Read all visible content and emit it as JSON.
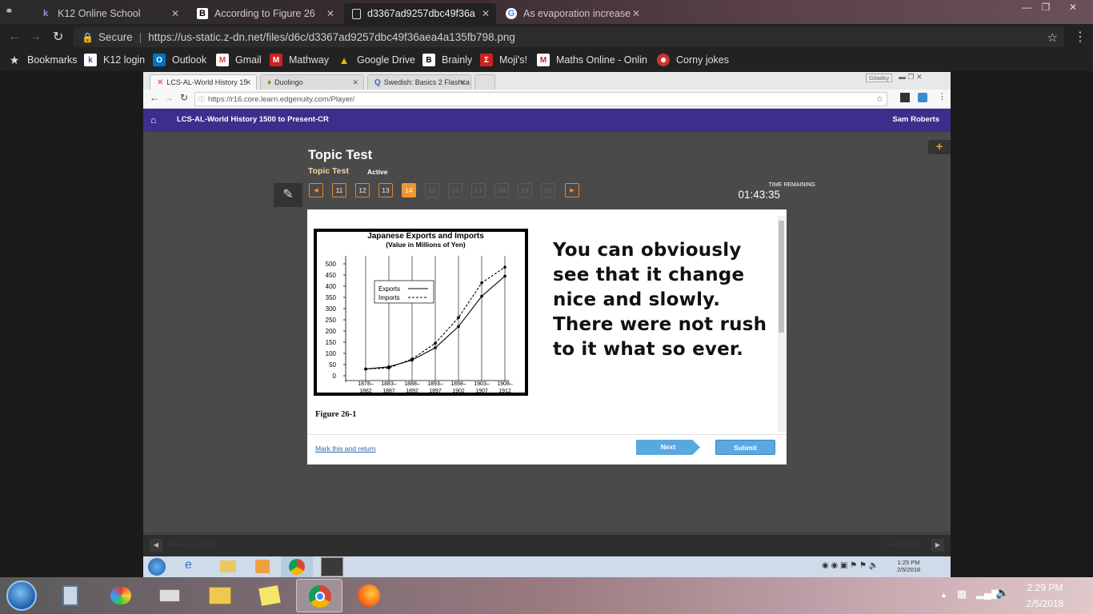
{
  "outer_tabs": [
    {
      "label": "K12 Online School",
      "icon": "k12-icon"
    },
    {
      "label": "According to Figure 26",
      "icon": "brainly-icon"
    },
    {
      "label": "d3367ad9257dbc49f36a",
      "icon": "page-icon"
    },
    {
      "label": "As evaporation increase",
      "icon": "google-icon"
    }
  ],
  "outer_toolbar": {
    "secure_label": "Secure",
    "url": "https://us-static.z-dn.net/files/d6c/d3367ad9257dbc49f36aea4a135fb798.png"
  },
  "bookmarks": [
    {
      "label": "Bookmarks"
    },
    {
      "label": "K12 login"
    },
    {
      "label": "Outlook"
    },
    {
      "label": "Gmail"
    },
    {
      "label": "Mathway"
    },
    {
      "label": "Google Drive"
    },
    {
      "label": "Brainly"
    },
    {
      "label": "Moji's!"
    },
    {
      "label": "Maths Online - Onlin"
    },
    {
      "label": "Corny jokes"
    }
  ],
  "inner_tabs": [
    {
      "label": "LCS-AL-World History 15"
    },
    {
      "label": "Duolingo"
    },
    {
      "label": "Swedish: Basics 2 Flashca"
    }
  ],
  "inner_url": "https://r16.core.learn.edgenuity.com/Player/",
  "inner_profile": "Gitadsy",
  "course": {
    "title": "LCS-AL-World History 1500 to Present-CR",
    "user": "Sam Roberts"
  },
  "test": {
    "heading": "Topic Test",
    "subheading": "Topic Test",
    "status": "Active",
    "time_label": "TIME REMAINING",
    "time_value": "01:43:35",
    "questions": [
      "11",
      "12",
      "13",
      "14",
      "15",
      "16",
      "17",
      "18",
      "19",
      "20"
    ],
    "current": "14"
  },
  "figure_caption": "Figure 26-1",
  "essay_text": "You can obviously see that it change nice and slowly. There were not rush to it what so ever.",
  "actions": {
    "mark_label": "Mark this and return",
    "next_label": "Next",
    "submit_label": "Submit"
  },
  "footer": {
    "prev_label": "Previous Activity",
    "next_label": "Next Activity"
  },
  "inner_clock": {
    "time": "1:25 PM",
    "date": "2/5/2018"
  },
  "clock": {
    "time": "2:29 PM",
    "date": "2/5/2018"
  },
  "chart_data": {
    "type": "line",
    "title": "Japanese Exports and Imports",
    "subtitle": "(Value in Millions of Yen)",
    "categories": [
      "1878-1882",
      "1883-1887",
      "1888-1892",
      "1893-1897",
      "1898-1902",
      "1903-1907",
      "1908-1912"
    ],
    "series": [
      {
        "name": "Exports",
        "values": [
          30,
          40,
          70,
          125,
          220,
          355,
          445
        ],
        "style": "solid"
      },
      {
        "name": "Imports",
        "values": [
          30,
          35,
          75,
          145,
          260,
          415,
          485
        ],
        "style": "dashed"
      }
    ],
    "y_ticks": [
      0,
      50,
      100,
      150,
      200,
      250,
      300,
      350,
      400,
      450,
      500
    ],
    "ylim": [
      0,
      500
    ],
    "legend": "top-left",
    "grid": true
  },
  "colors": {
    "header_purple": "#3d2d8c",
    "accent_orange": "#f09630",
    "button_blue": "#5aa8e0"
  }
}
